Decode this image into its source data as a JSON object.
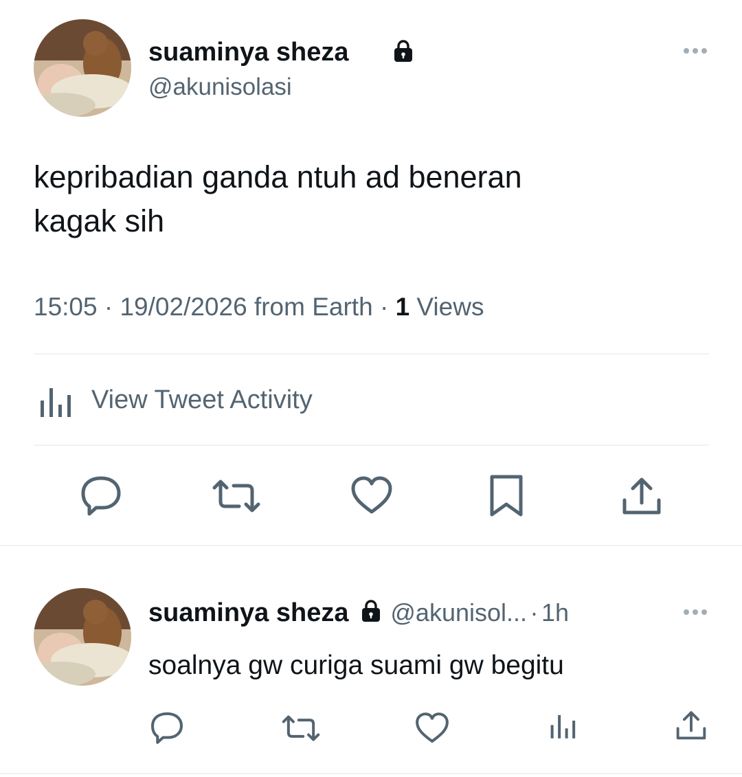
{
  "main_tweet": {
    "display_name": "suaminya sheza",
    "handle": "@akunisolasi",
    "text_line1": "kepribadian ganda ntuh ad beneran",
    "text_line2": "kagak sih",
    "time": "15:05",
    "sep1": "·",
    "date": "19/02/2026",
    "source": "from Earth",
    "sep2": "·",
    "views_count": "1",
    "views_label": "Views",
    "activity_label": "View Tweet Activity",
    "actions": [
      "reply-icon",
      "retweet-icon",
      "like-icon",
      "bookmark-icon",
      "share-icon"
    ]
  },
  "reply_tweet": {
    "display_name": "suaminya sheza",
    "handle": "@akunisol...",
    "sep": "·",
    "time_ago": "1h",
    "text": "soalnya gw curiga suami gw begitu",
    "actions": [
      "reply-icon",
      "retweet-icon",
      "like-icon",
      "views-icon",
      "share-icon"
    ]
  },
  "colors": {
    "text": "#0f1419",
    "secondary": "#536471",
    "divider": "#eff3f4"
  }
}
